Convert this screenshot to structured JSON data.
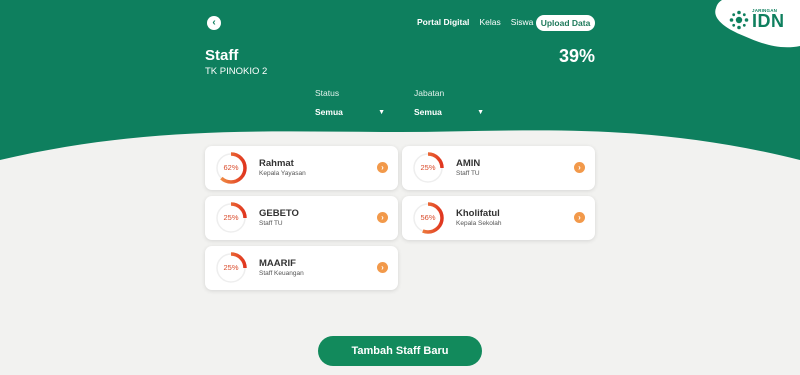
{
  "colors": {
    "brand_green": "#0e7f5e",
    "accent_orange": "#f2994a",
    "ring_red": "#e0361f",
    "ring_track": "#eeeeee",
    "background": "#f2f2f0"
  },
  "header": {
    "back_icon": "chevron-left-icon",
    "nav": [
      {
        "label": "Portal Digital",
        "active": true
      },
      {
        "label": "Kelas",
        "active": false
      },
      {
        "label": "Siswa",
        "active": false
      }
    ],
    "upload_label": "Upload Data"
  },
  "logo": {
    "sub": "JARINGAN",
    "main": "IDN",
    "icon": "network-dots-icon"
  },
  "page": {
    "title": "Staff",
    "subtitle": "TK PINOKIO 2",
    "overall_percent": "39%"
  },
  "filters": {
    "status": {
      "label": "Status",
      "value": "Semua"
    },
    "jabatan": {
      "label": "Jabatan",
      "value": "Semua"
    }
  },
  "staff": [
    {
      "name": "Rahmat",
      "role": "Kepala Yayasan",
      "percent_label": "62%",
      "progress": 0.62
    },
    {
      "name": "AMIN",
      "role": "Staff TU",
      "percent_label": "25%",
      "progress": 0.25
    },
    {
      "name": "GEBETO",
      "role": "Staff TU",
      "percent_label": "25%",
      "progress": 0.25
    },
    {
      "name": "Kholifatul",
      "role": "Kepala Sekolah",
      "percent_label": "56%",
      "progress": 0.56
    },
    {
      "name": "MAARIF",
      "role": "Staff Keuangan",
      "percent_label": "25%",
      "progress": 0.25
    }
  ],
  "actions": {
    "add_label": "Tambah Staff Baru"
  }
}
